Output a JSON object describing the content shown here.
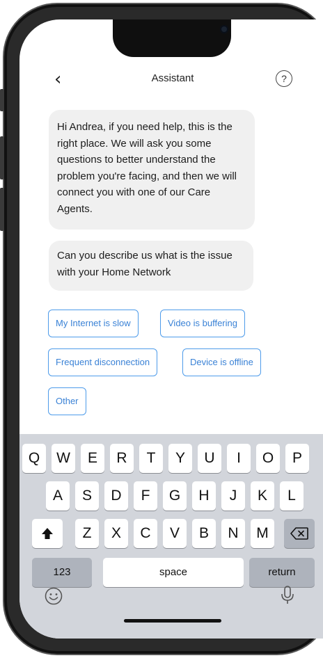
{
  "nav": {
    "back_glyph": "‹",
    "title": "Assistant",
    "help_glyph": "?"
  },
  "messages": [
    {
      "text": "Hi Andrea, if you need help, this is the right place. We will ask you some questions to better understand the problem you're facing, and then we will connect you with one of our Care Agents."
    },
    {
      "text": "Can you describe us what is the issue with your Home Network"
    }
  ],
  "quick_replies": [
    "My Internet is slow",
    "Video is buffering",
    "Frequent disconnection",
    "Device is offline",
    "Other"
  ],
  "keyboard": {
    "row1": [
      "Q",
      "W",
      "E",
      "R",
      "T",
      "Y",
      "U",
      "I",
      "O",
      "P"
    ],
    "row2": [
      "A",
      "S",
      "D",
      "F",
      "G",
      "H",
      "J",
      "K",
      "L"
    ],
    "row3": [
      "Z",
      "X",
      "C",
      "V",
      "B",
      "N",
      "M"
    ],
    "numbers_label": "123",
    "space_label": "space",
    "return_label": "return",
    "icons": {
      "shift": "shift-arrow-icon",
      "delete": "backspace-icon",
      "emoji": "emoji-icon",
      "mic": "microphone-icon"
    }
  },
  "colors": {
    "accent": "#3a82d6",
    "bubble": "#f0f0f0",
    "keyboard_bg": "#d2d5db"
  }
}
